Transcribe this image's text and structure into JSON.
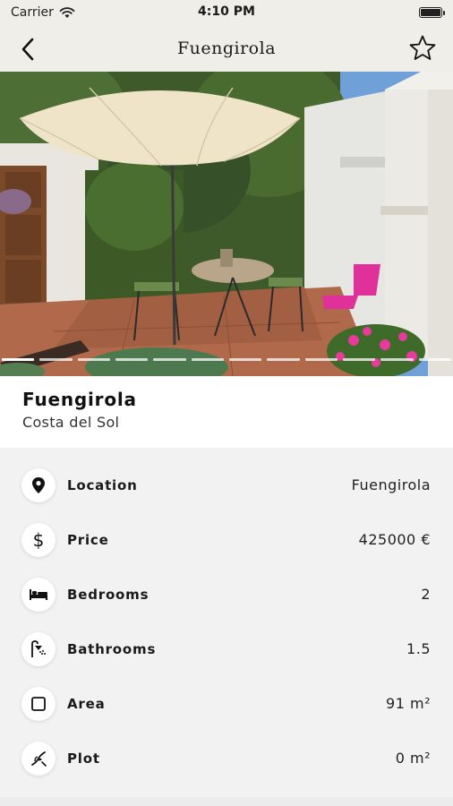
{
  "status_bar": {
    "carrier": "Carrier",
    "time": "4:10 PM"
  },
  "nav": {
    "title": "Fuengirola",
    "back_icon": "chevron-left-icon",
    "favorite_icon": "star-outline-icon"
  },
  "gallery": {
    "photo_count": 12,
    "current_index": 0
  },
  "property": {
    "name": "Fuengirola",
    "region": "Costa del Sol"
  },
  "details": [
    {
      "icon": "location-pin-icon",
      "label": "Location",
      "value": "Fuengirola"
    },
    {
      "icon": "dollar-icon",
      "label": "Price",
      "value": "425000 €"
    },
    {
      "icon": "bed-icon",
      "label": "Bedrooms",
      "value": "2"
    },
    {
      "icon": "shower-icon",
      "label": "Bathrooms",
      "value": "1.5"
    },
    {
      "icon": "square-icon",
      "label": "Area",
      "value": "91 m²"
    },
    {
      "icon": "plot-icon",
      "label": "Plot",
      "value": "0 m²"
    }
  ]
}
